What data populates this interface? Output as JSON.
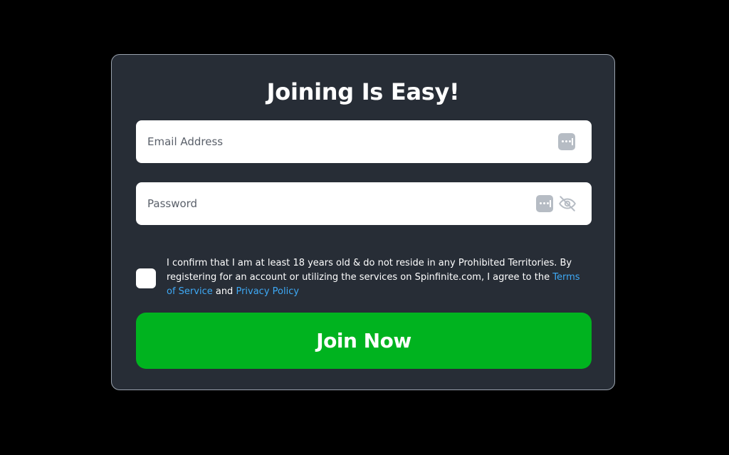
{
  "signup_form": {
    "title": "Joining Is Easy!",
    "email": {
      "placeholder": "Email Address",
      "value": ""
    },
    "password": {
      "placeholder": "Password",
      "value": ""
    },
    "consent": {
      "checked": false,
      "text_part1": "I confirm that I am at least 18 years old & do not reside in any Prohibited Territories. By registering for an account or utilizing the services on Spinfinite.com, I agree to the ",
      "terms_link": "Terms of Service",
      "text_part2": " and ",
      "privacy_link": "Privacy Policy"
    },
    "submit_label": "Join Now"
  },
  "icons": {
    "autofill": "password-manager-icon",
    "visibility": "eye-off-icon"
  },
  "colors": {
    "page_background": "#000000",
    "card_background": "#272d36",
    "card_border": "#9aa3ae",
    "link": "#3ea9f5",
    "primary_button": "#00b31f"
  }
}
